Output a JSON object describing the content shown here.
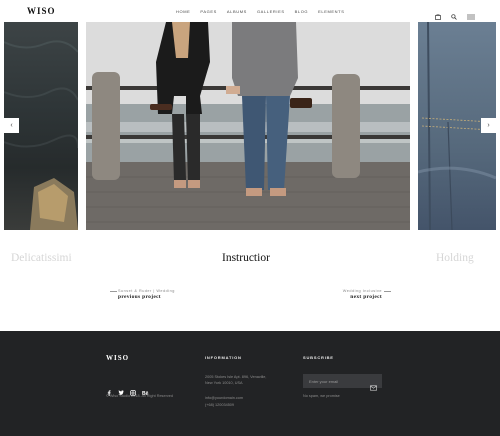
{
  "brand": {
    "logo": "WISO"
  },
  "nav": {
    "items": [
      "HOME",
      "PAGES",
      "ALBUMS",
      "GALLERIES",
      "BLOG",
      "ELEMENTS"
    ]
  },
  "slider": {
    "captions": {
      "left": "Delicatissimi",
      "center": "Instructior",
      "right": "Holding"
    }
  },
  "pagination": {
    "previous": {
      "category": "Sunset & Ruder | Wedding",
      "title": "previous project"
    },
    "next": {
      "category": "Wedding Inclusive",
      "title": "next project"
    }
  },
  "footer": {
    "logo": "WISO",
    "copyright": "© Wiso Studio 2018. All Right Reserved",
    "information": {
      "heading": "INFORMATION",
      "address_1": "2005 Stokes Isle Apt. 896, Venaville,",
      "address_2": "New York 10010, USA",
      "email": "info@yourdomain.com",
      "phone": "(+68) 120034509"
    },
    "subscribe": {
      "heading": "SUBSCRIBE",
      "placeholder": "Enter your email",
      "note": "No spam, we promise"
    }
  },
  "colors": {
    "footer_bg": "#222325",
    "text": "#222222",
    "muted_caption": "#d6d6d6"
  }
}
